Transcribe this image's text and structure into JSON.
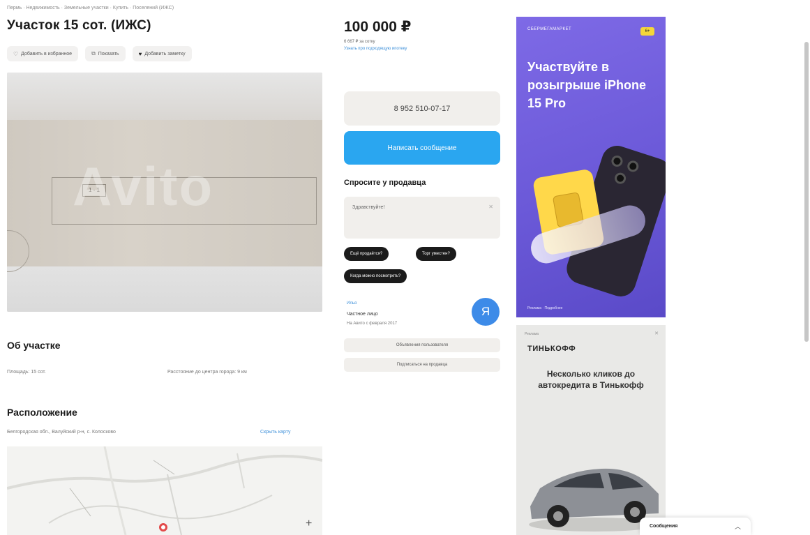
{
  "breadcrumbs": "Пермь · Недвижимость · Земельные участки · Купить · Поселений (ИЖС)",
  "listing": {
    "title": "Участок 15 сот. (ИЖС)",
    "actions": [
      {
        "label": "Добавить в избранное",
        "icon": "heart-icon"
      },
      {
        "label": "Показать",
        "icon": "share-icon"
      },
      {
        "label": "Добавить заметку",
        "icon": "note-icon"
      }
    ],
    "photo_watermark": "Avito",
    "photo_plan_label": "1 - 1"
  },
  "about": {
    "heading": "Об участке",
    "area": "Площадь: 15 сот.",
    "distance": "Расстояние до центра города: 9 км"
  },
  "location": {
    "heading": "Расположение",
    "address": "Белгородская обл., Валуйский р-н, с. Колосково",
    "hide_map": "Скрыть карту"
  },
  "price": {
    "value": "100 000 ₽",
    "per_unit": "6 667 ₽ за сотку",
    "link": "Узнать про подходящую ипотеку"
  },
  "contact": {
    "phone": "8 952 510-07-17",
    "message_button": "Написать сообщение",
    "ask_heading": "Спросите у продавца",
    "ask_placeholder": "Здравствуйте!",
    "quick_questions": [
      "Ещё продаётся?",
      "Торг уместен?",
      "Когда можно посмотреть?"
    ]
  },
  "seller": {
    "name_link": "Илья",
    "type": "Частное лицо",
    "since": "На Авито с февраля 2017",
    "avatar_letter": "Я",
    "subscribe": "Подписаться на продавца",
    "other_listings": "Объявления пользователя"
  },
  "ads": {
    "ad1": {
      "brand": "СБЕРМЕГАМАРКЕТ",
      "tag": "6+",
      "headline": "Участвуйте в розыгрыше iPhone 15 Pro",
      "footer": "Реклама · Подробнее"
    },
    "ad2": {
      "mark": "Реклама",
      "brand": "ТИНЬКОФФ",
      "headline": "Несколько кликов до автокредита в Тинькофф"
    }
  },
  "chat": {
    "label": "Сообщения"
  }
}
